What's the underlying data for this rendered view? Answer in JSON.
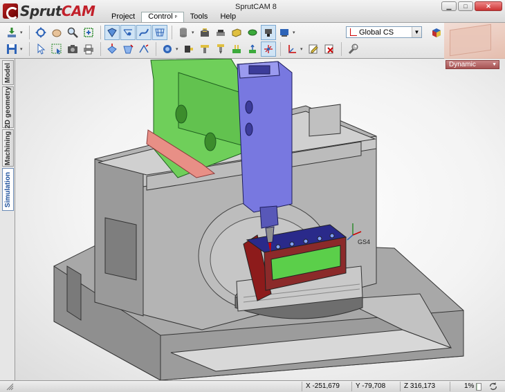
{
  "app": {
    "logo_part1": "Sprut",
    "logo_part2": "CAM",
    "window_title": "SprutCAM 8"
  },
  "menu": {
    "items": [
      {
        "label": "Project"
      },
      {
        "label": "Control",
        "pin": "ᵖ"
      },
      {
        "label": "Tools"
      },
      {
        "label": "Help"
      }
    ]
  },
  "toolbar": {
    "coord_system": "Global CS",
    "colors": {
      "accent": "#2e64b8",
      "machine_gray": "#8c8c8c",
      "green_part": "#6fcf5a"
    }
  },
  "side_tabs": {
    "model": "Model",
    "geometry2d": "2D geometry",
    "machining": "Machining",
    "simulation": "Simulation"
  },
  "viewport": {
    "render_mode": "Dynamic",
    "cs_label": "GS4"
  },
  "status": {
    "x": "X -251,679",
    "y": "Y -79,708",
    "z": "Z 316,173",
    "progress": "1%"
  }
}
